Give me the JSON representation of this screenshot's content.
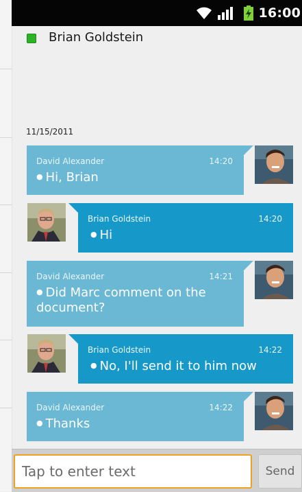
{
  "status_bar": {
    "time": "16:00",
    "icons": [
      "wifi-icon",
      "signal-icon",
      "battery-charging-icon"
    ]
  },
  "header": {
    "contact_name": "Brian Goldstein",
    "presence_color": "#2bb526",
    "presence_status": "online"
  },
  "conversation": {
    "date": "11/15/2011",
    "messages": [
      {
        "sender": "David Alexander",
        "time": "14:20",
        "text": "Hi, Brian",
        "direction": "incoming"
      },
      {
        "sender": "Brian Goldstein",
        "time": "14:20",
        "text": "Hi",
        "direction": "outgoing"
      },
      {
        "sender": "David Alexander",
        "time": "14:21",
        "text": "Did Marc comment on the document?",
        "direction": "incoming"
      },
      {
        "sender": "Brian Goldstein",
        "time": "14:22",
        "text": "No, I'll send it to him now",
        "direction": "outgoing"
      },
      {
        "sender": "David Alexander",
        "time": "14:22",
        "text": "Thanks",
        "direction": "incoming"
      }
    ]
  },
  "composer": {
    "placeholder": "Tap to enter text",
    "value": "",
    "send_label": "Send"
  },
  "colors": {
    "incoming_bubble": "#6ab8d3",
    "outgoing_bubble": "#1699c8",
    "input_focus_border": "#f0a020"
  }
}
